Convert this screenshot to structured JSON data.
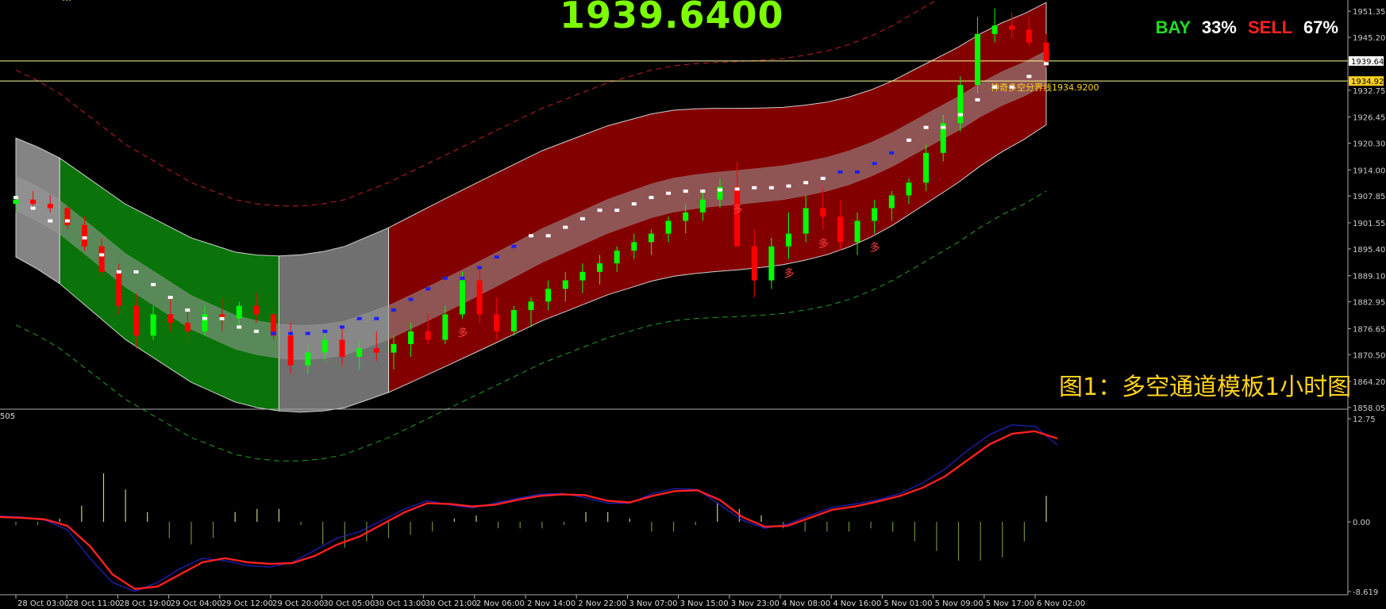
{
  "header": {
    "price_big": "1939.6400",
    "ratio": {
      "bay_label": "BAY",
      "bay_value": "33%",
      "sell_label": "SELL",
      "sell_value": "67%"
    },
    "top_text": "…"
  },
  "caption": "图1：多空通道模板1小时图",
  "annotations": {
    "divider_line_label": "神奇多空分界线1934.9200",
    "current_price_tag": "1939.64",
    "divider_price_tag": "1934.92",
    "signal_text": "多",
    "indicator_label": "505"
  },
  "colors": {
    "background": "#000000",
    "bull_candle": "#00FF00",
    "bear_candle": "#FF0000",
    "channel_green": "#0B7A0B",
    "channel_red": "#8B0000",
    "band_gray": "#8C8C8C",
    "price_line": "#FFFF99",
    "macd_main": "#FF2020",
    "macd_signal": "#2222CC",
    "histogram": "#CCCC88",
    "accent_yellow": "#FFD21E",
    "bay_green": "#22DD22",
    "sell_red": "#FF2222"
  },
  "chart_data": [
    {
      "type": "candlestick",
      "symbol_timeframe": "1 hour",
      "ylim": [
        1858.05,
        1952.5
      ],
      "y_ticks": [
        "1951.35",
        "1945.20",
        "1932.75",
        "1926.45",
        "1920.30",
        "1914.00",
        "1907.85",
        "1901.55",
        "1895.40",
        "1889.10",
        "1882.95",
        "1876.65",
        "1870.50",
        "1864.20",
        "1858.05"
      ],
      "x_ticks": [
        "28 Oct 03:00",
        "28 Oct 11:00",
        "28 Oct 19:00",
        "29 Oct 04:00",
        "29 Oct 12:00",
        "29 Oct 20:00",
        "30 Oct 05:00",
        "30 Oct 13:00",
        "30 Oct 21:00",
        "2 Nov 06:00",
        "2 Nov 14:00",
        "2 Nov 22:00",
        "3 Nov 07:00",
        "3 Nov 15:00",
        "3 Nov 23:00",
        "4 Nov 08:00",
        "4 Nov 16:00",
        "5 Nov 01:00",
        "5 Nov 09:00",
        "5 Nov 17:00",
        "6 Nov 02:00"
      ],
      "horizontal_lines": [
        1939.64,
        1934.92
      ],
      "channel_mid": [
        1907.5,
        1905,
        1902,
        1898,
        1894,
        1890,
        1887,
        1884,
        1881,
        1879,
        1877,
        1876,
        1875.5,
        1875.5,
        1876,
        1877,
        1879,
        1881,
        1883.5,
        1886,
        1888.5,
        1891,
        1893.5,
        1896,
        1898.5,
        1900.5,
        1902.5,
        1904.5,
        1906,
        1907.5,
        1908.5,
        1909,
        1909.3,
        1909.5,
        1909.8,
        1910.2,
        1911,
        1912,
        1913.5,
        1915.5,
        1918,
        1921,
        1924,
        1927,
        1930.5,
        1933.5,
        1936,
        1939
      ],
      "candles_ohlc": [
        [
          1906,
          1908,
          1904,
          1907
        ],
        [
          1907,
          1909,
          1905,
          1906
        ],
        [
          1906,
          1908,
          1904,
          1905
        ],
        [
          1905,
          1906,
          1900,
          1901
        ],
        [
          1901,
          1903,
          1895,
          1896
        ],
        [
          1896,
          1898,
          1889,
          1890
        ],
        [
          1890,
          1892,
          1880,
          1882
        ],
        [
          1882,
          1885,
          1872,
          1875
        ],
        [
          1875,
          1882,
          1874,
          1880
        ],
        [
          1880,
          1884,
          1876,
          1878
        ],
        [
          1878,
          1881,
          1874,
          1876
        ],
        [
          1876,
          1882,
          1875,
          1880
        ],
        [
          1880,
          1884,
          1876,
          1879
        ],
        [
          1879,
          1883,
          1877,
          1882
        ],
        [
          1882,
          1885,
          1878,
          1880
        ],
        [
          1880,
          1882,
          1874,
          1875
        ],
        [
          1875,
          1878,
          1866,
          1868
        ],
        [
          1868,
          1873,
          1866,
          1871
        ],
        [
          1871,
          1876,
          1869,
          1874
        ],
        [
          1874,
          1877,
          1868,
          1870
        ],
        [
          1870,
          1874,
          1867,
          1872
        ],
        [
          1872,
          1876,
          1869,
          1871
        ],
        [
          1871,
          1875,
          1867,
          1873
        ],
        [
          1873,
          1878,
          1870,
          1876
        ],
        [
          1876,
          1880,
          1873,
          1874
        ],
        [
          1874,
          1882,
          1873,
          1880
        ],
        [
          1880,
          1890,
          1879,
          1888
        ],
        [
          1888,
          1891,
          1878,
          1880
        ],
        [
          1880,
          1884,
          1874,
          1876
        ],
        [
          1876,
          1882,
          1875,
          1881
        ],
        [
          1881,
          1884,
          1877,
          1883
        ],
        [
          1883,
          1888,
          1881,
          1886
        ],
        [
          1886,
          1890,
          1883,
          1888
        ],
        [
          1888,
          1892,
          1885,
          1890
        ],
        [
          1890,
          1894,
          1887,
          1892
        ],
        [
          1892,
          1896,
          1890,
          1895
        ],
        [
          1895,
          1899,
          1893,
          1897
        ],
        [
          1897,
          1900,
          1894,
          1899
        ],
        [
          1899,
          1903,
          1897,
          1902
        ],
        [
          1902,
          1906,
          1899,
          1904
        ],
        [
          1904,
          1909,
          1902,
          1907
        ],
        [
          1907,
          1912,
          1905,
          1910
        ],
        [
          1910,
          1916,
          1908,
          1896
        ],
        [
          1896,
          1900,
          1884,
          1888
        ],
        [
          1888,
          1898,
          1886,
          1896
        ],
        [
          1896,
          1904,
          1893,
          1899
        ],
        [
          1899,
          1908,
          1897,
          1905
        ],
        [
          1905,
          1910,
          1900,
          1903
        ],
        [
          1903,
          1907,
          1895,
          1897
        ],
        [
          1897,
          1904,
          1894,
          1902
        ],
        [
          1902,
          1907,
          1899,
          1905
        ],
        [
          1905,
          1909,
          1902,
          1908
        ],
        [
          1908,
          1912,
          1906,
          1911
        ],
        [
          1911,
          1920,
          1909,
          1918
        ],
        [
          1918,
          1927,
          1916,
          1925
        ],
        [
          1925,
          1936,
          1923,
          1934
        ],
        [
          1934,
          1950,
          1932,
          1946
        ],
        [
          1946,
          1952,
          1944,
          1948
        ],
        [
          1948,
          1951,
          1945,
          1947
        ],
        [
          1947,
          1950,
          1943,
          1944
        ],
        [
          1944,
          1946,
          1938,
          1939.64
        ]
      ]
    },
    {
      "type": "line",
      "name": "505",
      "ylim": [
        -8.619,
        12.75
      ],
      "y_ticks": [
        "12.75",
        "0.00",
        "-8.619"
      ],
      "series": [
        {
          "name": "main",
          "values": [
            0.6,
            0.5,
            0.3,
            -0.5,
            -3,
            -6.5,
            -8.3,
            -8,
            -6.5,
            -5,
            -4.5,
            -5,
            -5.2,
            -5.1,
            -4.2,
            -2.8,
            -1.8,
            -0.3,
            1.2,
            2.3,
            2.2,
            1.9,
            2.1,
            2.7,
            3.2,
            3.4,
            3.3,
            2.6,
            2.4,
            3.2,
            3.8,
            3.9,
            2.7,
            0.6,
            -0.6,
            -0.5,
            0.5,
            1.5,
            1.9,
            2.5,
            3.2,
            4.2,
            5.6,
            7.6,
            9.6,
            10.9,
            11.2,
            10.3
          ]
        },
        {
          "name": "signal",
          "values": [
            0.7,
            0.6,
            0.2,
            -1,
            -4.5,
            -7.5,
            -8.6,
            -7.5,
            -5.8,
            -4.5,
            -4.8,
            -5.4,
            -5.6,
            -5,
            -3.5,
            -2,
            -1.2,
            0.2,
            1.6,
            2.6,
            2.1,
            1.7,
            2.3,
            2.9,
            3.4,
            3.5,
            3,
            2.3,
            2.3,
            3.5,
            4.1,
            4,
            2.1,
            0.2,
            -0.8,
            -0.3,
            0.8,
            1.8,
            2.2,
            2.7,
            3.5,
            4.8,
            6.5,
            8.8,
            10.8,
            12,
            11.8,
            9.5
          ]
        },
        {
          "name": "histogram",
          "values": [
            -0.1,
            -0.1,
            0.1,
            0.5,
            1.5,
            1.0,
            0.3,
            -0.5,
            -0.7,
            -0.5,
            0.3,
            0.4,
            0.4,
            -0.1,
            -0.7,
            -0.8,
            -0.6,
            -0.5,
            -0.4,
            -0.3,
            0.1,
            0.2,
            -0.2,
            -0.2,
            -0.2,
            -0.1,
            0.3,
            0.3,
            0.1,
            -0.3,
            -0.3,
            -0.1,
            0.6,
            0.4,
            0.2,
            -0.2,
            -0.3,
            -0.3,
            -0.3,
            -0.2,
            -0.3,
            -0.6,
            -0.9,
            -1.2,
            -1.2,
            -1.1,
            -0.6,
            0.8
          ]
        }
      ]
    }
  ]
}
